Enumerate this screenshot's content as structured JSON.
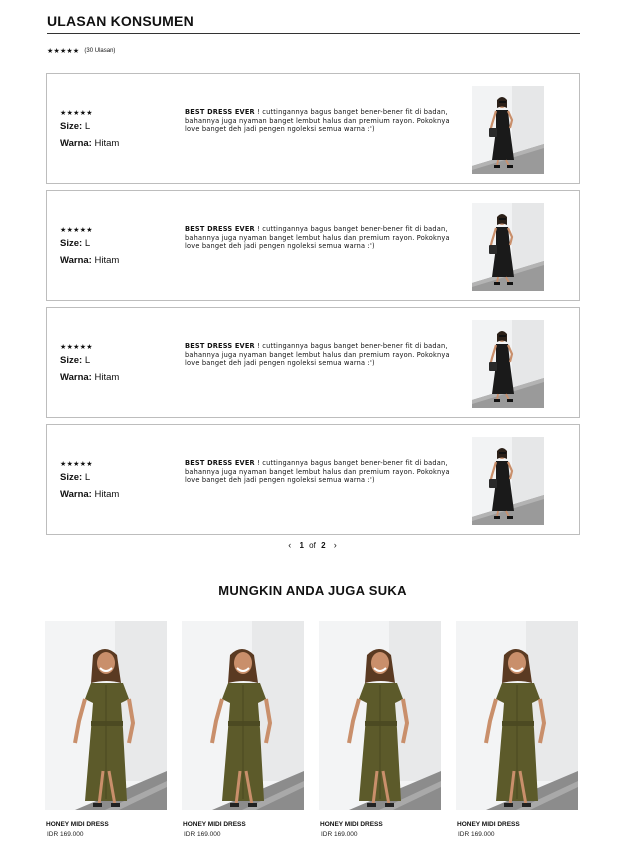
{
  "section": {
    "title": "ULASAN KONSUMEN",
    "rating_stars": "★★★★★",
    "review_count": "(30 Ulasan)"
  },
  "reviews": [
    {
      "stars": "★★★★★",
      "size_label": "Size:",
      "size": "L",
      "color_label": "Warna:",
      "color": "Hitam",
      "headline": "BEST DRESS EVER",
      "body": " ! cuttingannya bagus banget bener-bener fit di badan, bahannya juga nyaman banget lembut halus dan premium rayon. Pokoknya love banget deh jadi pengen ngoleksi semua warna :')"
    },
    {
      "stars": "★★★★★",
      "size_label": "Size:",
      "size": "L",
      "color_label": "Warna:",
      "color": "Hitam",
      "headline": "BEST DRESS EVER",
      "body": " ! cuttingannya bagus banget bener-bener fit di badan, bahannya juga nyaman banget lembut halus dan premium rayon. Pokoknya love banget deh jadi pengen ngoleksi semua warna :')"
    },
    {
      "stars": "★★★★★",
      "size_label": "Size:",
      "size": "L",
      "color_label": "Warna:",
      "color": "Hitam",
      "headline": "BEST DRESS EVER",
      "body": " ! cuttingannya bagus banget bener-bener fit di badan, bahannya juga nyaman banget lembut halus dan premium rayon. Pokoknya love banget deh jadi pengen ngoleksi semua warna :')"
    },
    {
      "stars": "★★★★★",
      "size_label": "Size:",
      "size": "L",
      "color_label": "Warna:",
      "color": "Hitam",
      "headline": "BEST DRESS EVER",
      "body": " ! cuttingannya bagus banget bener-bener fit di badan, bahannya juga nyaman banget lembut halus dan premium rayon. Pokoknya love banget deh jadi pengen ngoleksi semua warna :')"
    }
  ],
  "pagination": {
    "prev_icon": "chevron-left-icon",
    "current": "1",
    "of": "of",
    "total": "2",
    "next_icon": "chevron-right-icon"
  },
  "suggestions": {
    "title": "MUNGKIN ANDA JUGA SUKA",
    "products": [
      {
        "name": "HONEY MIDI DRESS",
        "price": "IDR 169.000"
      },
      {
        "name": "HONEY MIDI DRESS",
        "price": "IDR 169.000"
      },
      {
        "name": "HONEY MIDI DRESS",
        "price": "IDR 169.000"
      },
      {
        "name": "HONEY MIDI DRESS",
        "price": "IDR 169.000"
      }
    ]
  },
  "colors": {
    "dress_black": "#1a1a1a",
    "dress_olive": "#5c5a2a",
    "skin": "#c98f6b",
    "hair": "#5a3a22",
    "paving": "#8a8a8a"
  }
}
